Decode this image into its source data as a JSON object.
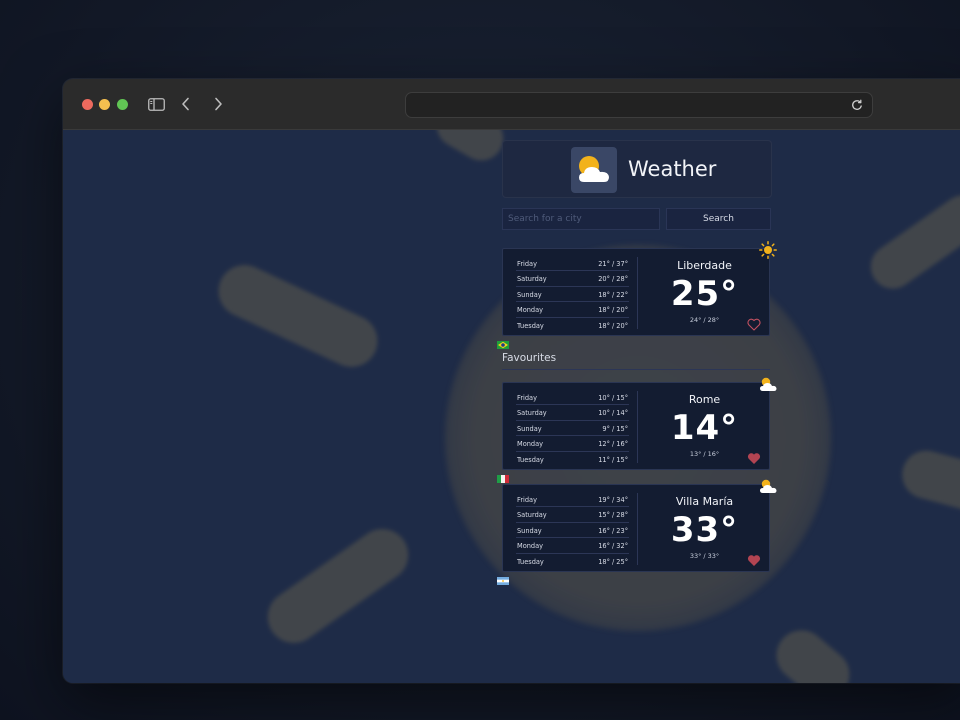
{
  "window": {
    "url": ""
  },
  "header": {
    "title": "Weather",
    "logo_icon": "sun-behind-cloud-icon"
  },
  "search": {
    "placeholder": "Search for a city",
    "button_label": "Search"
  },
  "current": {
    "city": "Liberdade",
    "temperature": "25°",
    "minmax": "24° / 28°",
    "weather_icon": "sun-icon",
    "flag": "brazil-flag-icon",
    "favourite": false,
    "forecast": [
      {
        "day": "Friday",
        "temps": "21° / 37°"
      },
      {
        "day": "Saturday",
        "temps": "20° / 28°"
      },
      {
        "day": "Sunday",
        "temps": "18° / 22°"
      },
      {
        "day": "Monday",
        "temps": "18° / 20°"
      },
      {
        "day": "Tuesday",
        "temps": "18° / 20°"
      }
    ]
  },
  "favourites": {
    "title": "Favourites",
    "items": [
      {
        "city": "Rome",
        "temperature": "14°",
        "minmax": "13° / 16°",
        "weather_icon": "sun-behind-cloud-icon",
        "flag": "italy-flag-icon",
        "favourite": true,
        "forecast": [
          {
            "day": "Friday",
            "temps": "10° / 15°"
          },
          {
            "day": "Saturday",
            "temps": "10° / 14°"
          },
          {
            "day": "Sunday",
            "temps": "9° / 15°"
          },
          {
            "day": "Monday",
            "temps": "12° / 16°"
          },
          {
            "day": "Tuesday",
            "temps": "11° / 15°"
          }
        ]
      },
      {
        "city": "Villa María",
        "temperature": "33°",
        "minmax": "33° / 33°",
        "weather_icon": "sun-behind-cloud-icon",
        "flag": "argentina-flag-icon",
        "favourite": true,
        "forecast": [
          {
            "day": "Friday",
            "temps": "19° / 34°"
          },
          {
            "day": "Saturday",
            "temps": "15° / 28°"
          },
          {
            "day": "Sunday",
            "temps": "16° / 23°"
          },
          {
            "day": "Monday",
            "temps": "16° / 32°"
          },
          {
            "day": "Tuesday",
            "temps": "18° / 25°"
          }
        ]
      }
    ]
  },
  "colors": {
    "background": "#1e2b47",
    "card": "#131c31",
    "accent_sun": "#f2b21b",
    "heart_filled": "#b24452",
    "heart_outline": "#c05060"
  }
}
